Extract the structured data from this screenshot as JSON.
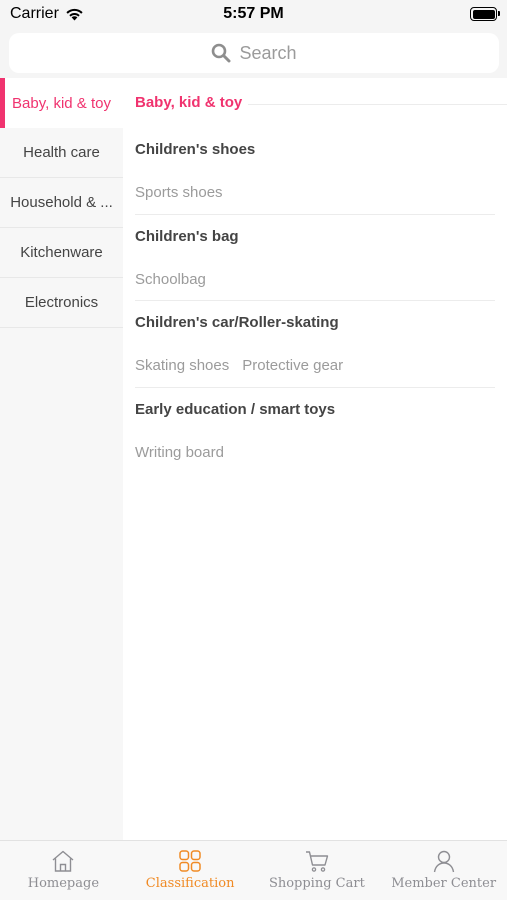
{
  "status_bar": {
    "carrier": "Carrier",
    "time": "5:57 PM"
  },
  "search": {
    "placeholder": "Search"
  },
  "sidebar": {
    "items": [
      {
        "label": "Baby, kid & toy",
        "active": true
      },
      {
        "label": "Health care"
      },
      {
        "label": "Household & ..."
      },
      {
        "label": "Kitchenware"
      },
      {
        "label": "Electronics"
      }
    ]
  },
  "content": {
    "header": "Baby, kid & toy",
    "groups": [
      {
        "title": "Children's shoes",
        "tags": [
          "Sports shoes"
        ]
      },
      {
        "title": "Children's bag",
        "tags": [
          "Schoolbag"
        ]
      },
      {
        "title": "Children's car/Roller-skating",
        "tags": [
          "Skating shoes",
          "Protective gear"
        ]
      },
      {
        "title": "Early education / smart toys",
        "tags": [
          "Writing board"
        ]
      }
    ]
  },
  "tabbar": {
    "tabs": [
      {
        "label": "Homepage",
        "icon": "home-icon"
      },
      {
        "label": "Classification",
        "icon": "grid-icon",
        "active": true
      },
      {
        "label": "Shopping Cart",
        "icon": "cart-icon"
      },
      {
        "label": "Member Center",
        "icon": "person-icon"
      }
    ]
  },
  "colors": {
    "accent": "#f0336f",
    "tab_active": "#f08a24"
  }
}
